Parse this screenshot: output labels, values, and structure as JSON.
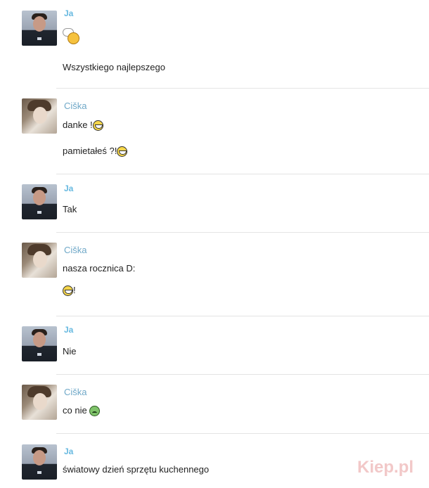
{
  "messages": [
    {
      "sender": "Ja",
      "lines": [
        "Wszystkiego najlepszego"
      ],
      "emoticons": [
        "wave-smiley-icon"
      ]
    },
    {
      "sender": "Ciška",
      "lines": [
        "danke !",
        "pamietałeś ?!"
      ],
      "emoticons": [
        "grin-icon",
        "grin-icon"
      ]
    },
    {
      "sender": "Ja",
      "lines": [
        "Tak"
      ]
    },
    {
      "sender": "Ciška",
      "lines": [
        "nasza rocznica D:",
        "!"
      ],
      "emoticons": [
        "grin-icon"
      ]
    },
    {
      "sender": "Ja",
      "lines": [
        "Nie"
      ]
    },
    {
      "sender": "Ciška",
      "lines": [
        "co nie"
      ],
      "emoticons": [
        "green-smiley-icon"
      ]
    },
    {
      "sender": "Ja",
      "lines": [
        "światowy dzień sprzętu kuchennego"
      ]
    }
  ],
  "watermark": "Kiep.pl",
  "colors": {
    "name_ja": "#67b9e0",
    "name_ciska": "#6fa8c8",
    "separator": "#e4e4e4"
  }
}
